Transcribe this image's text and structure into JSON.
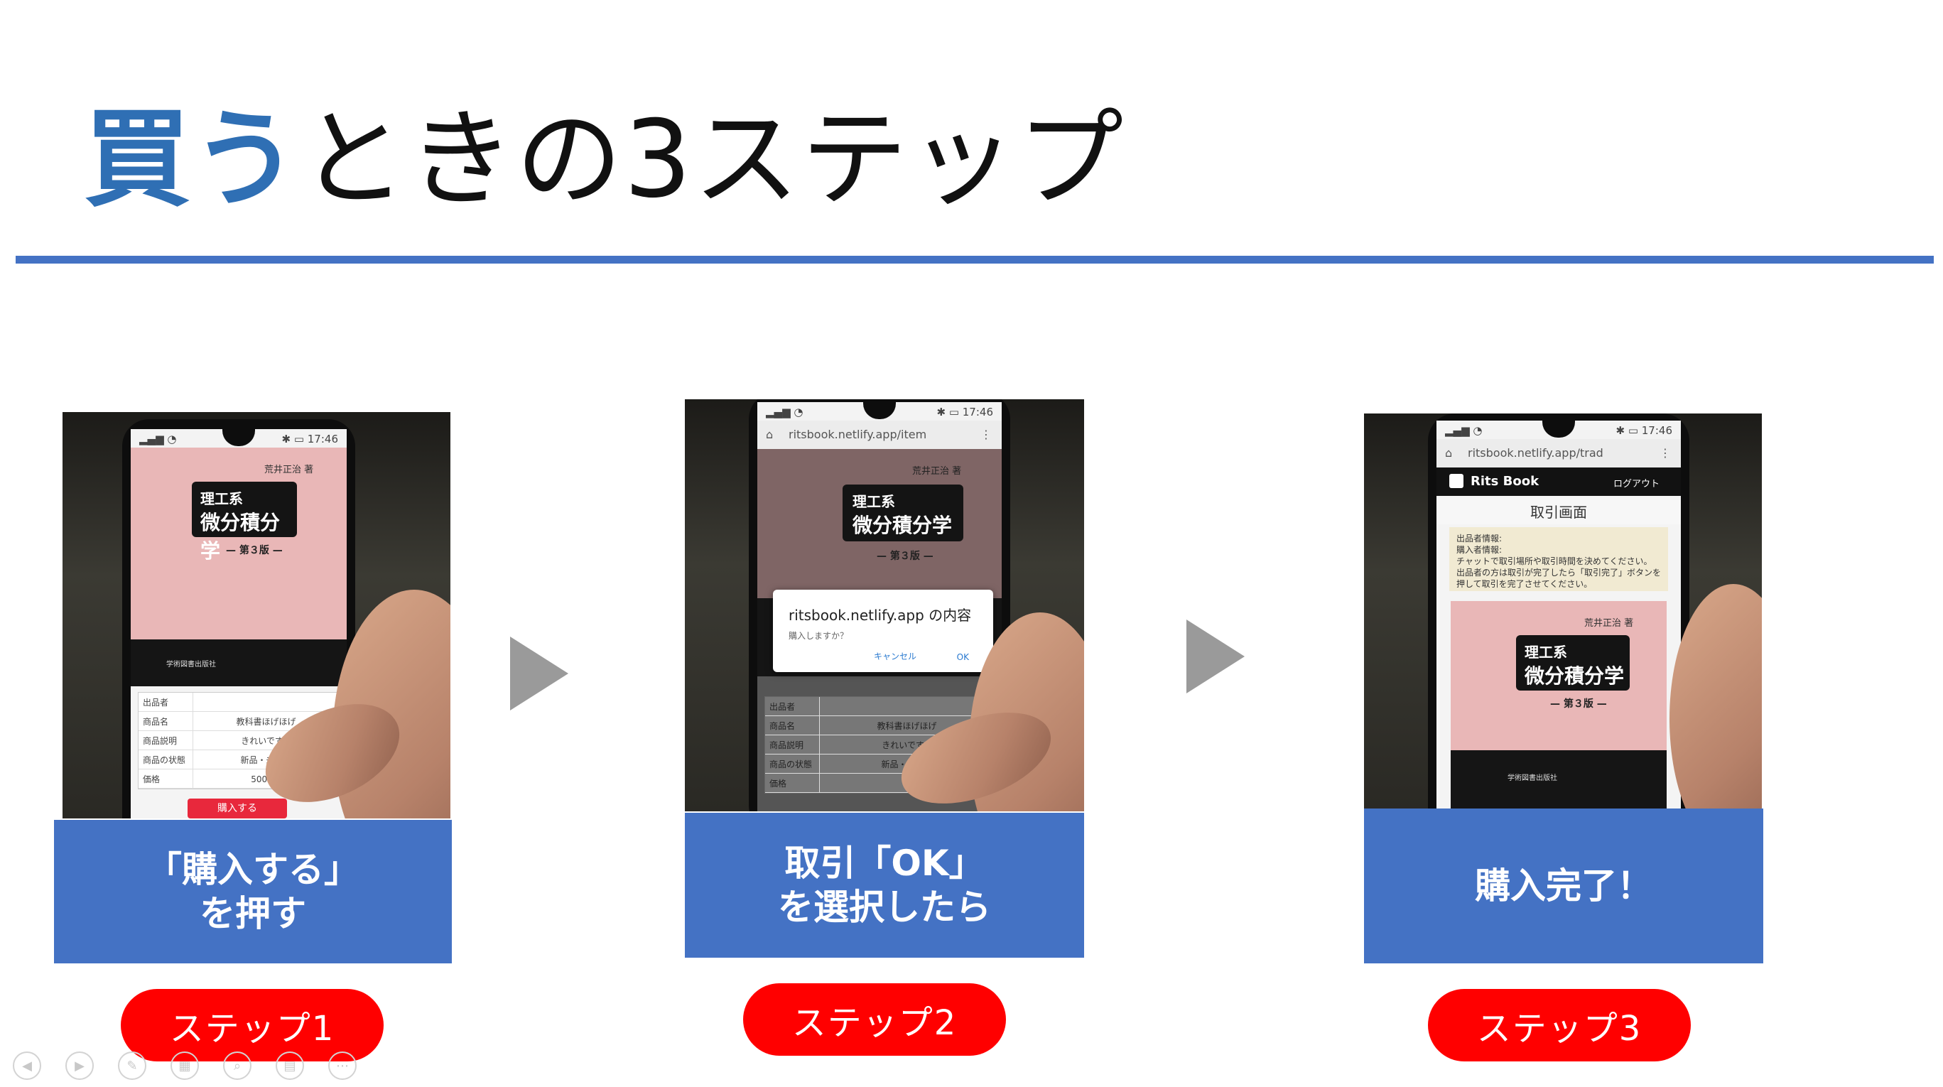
{
  "slide": {
    "title_accent": "買う",
    "title_rest": "ときの3ステップ"
  },
  "steps": [
    {
      "pill": "ステップ1",
      "caption_line1": "「購入する」",
      "caption_line2": "を押す",
      "phone": {
        "book_author": "荒井正治 著",
        "book_subtitle": "理工系",
        "book_title": "微分積分学",
        "book_edition": "— 第３版 —",
        "publisher": "学術図書出版社",
        "table": [
          {
            "k": "出品者",
            "v": ""
          },
          {
            "k": "商品名",
            "v": "教科書ほげほげ"
          },
          {
            "k": "商品説明",
            "v": "きれいです。"
          },
          {
            "k": "商品の状態",
            "v": "新品・未使用"
          },
          {
            "k": "価格",
            "v": "5000円"
          }
        ],
        "buy_button": "購入する"
      }
    },
    {
      "pill": "ステップ2",
      "caption_line1": "取引「OK」",
      "caption_line2": "を選択したら",
      "phone": {
        "url": "ritsbook.netlify.app/item",
        "book_author": "荒井正治 著",
        "book_subtitle": "理工系",
        "book_title": "微分積分学",
        "book_edition": "— 第３版 —",
        "dialog_title": "ritsbook.netlify.app の内容",
        "dialog_message": "購入しますか？",
        "dialog_cancel": "キャンセル",
        "dialog_ok": "OK",
        "table": [
          {
            "k": "出品者",
            "v": ""
          },
          {
            "k": "商品名",
            "v": "教科書ほげほげ"
          },
          {
            "k": "商品説明",
            "v": "きれいです。"
          },
          {
            "k": "商品の状態",
            "v": "新品・未使用"
          },
          {
            "k": "価格",
            "v": ""
          }
        ]
      }
    },
    {
      "pill": "ステップ3",
      "caption_line1": "購入完了！",
      "phone": {
        "url": "ritsbook.netlify.app/trad",
        "app_name": "Rits Book",
        "logout": "ログアウト",
        "deal_title": "取引画面",
        "info_lines": [
          "出品者情報:",
          "購入者情報:",
          "チャットで取引場所や取引時間を決めてください。",
          "出品者の方は取引が完了したら「取引完了」ボタンを",
          "押して取引を完了させてください。"
        ],
        "book_author": "荒井正治 著",
        "book_subtitle": "理工系",
        "book_title": "微分積分学",
        "book_edition": "— 第３版 —",
        "publisher": "学術図書出版社"
      }
    }
  ],
  "colors": {
    "accent_blue": "#2f6fb4",
    "rule_blue": "#4472c4",
    "caption_blue": "#4472c4",
    "pill_red": "#ff0000",
    "arrow_gray": "#9a9a9a"
  },
  "nav_icons": [
    "previous-icon",
    "next-icon",
    "pen-icon",
    "slides-icon",
    "zoom-icon",
    "subtitles-icon",
    "more-icon"
  ]
}
